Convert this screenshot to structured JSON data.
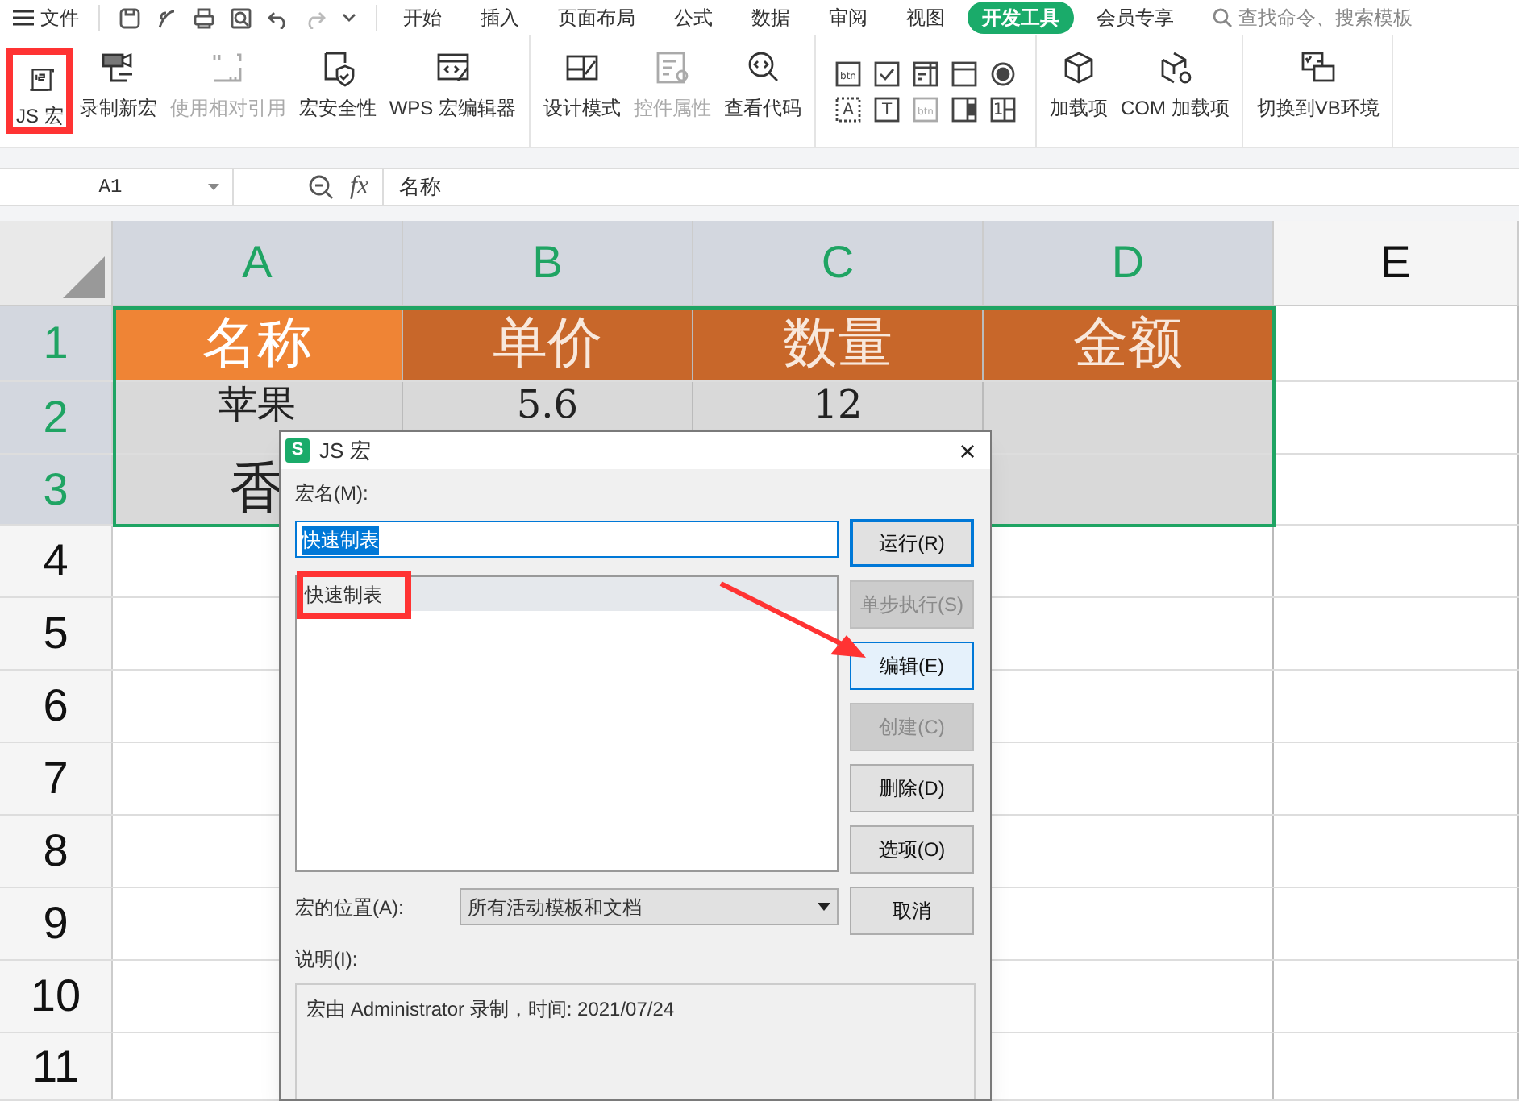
{
  "menu": {
    "label": "文件",
    "tabs": [
      {
        "label": "开始",
        "selected": false
      },
      {
        "label": "插入",
        "selected": false
      },
      {
        "label": "页面布局",
        "selected": false
      },
      {
        "label": "公式",
        "selected": false
      },
      {
        "label": "数据",
        "selected": false
      },
      {
        "label": "审阅",
        "selected": false
      },
      {
        "label": "视图",
        "selected": false
      },
      {
        "label": "开发工具",
        "selected": true
      },
      {
        "label": "会员专享",
        "selected": false
      }
    ],
    "search": {
      "placeholder": "查找命令、搜索模板"
    }
  },
  "ribbon": {
    "groups": [
      [
        {
          "label": "JS 宏",
          "disabled": false,
          "highlighted": true
        },
        {
          "label": "录制新宏",
          "disabled": false,
          "highlighted": false
        },
        {
          "label": "使用相对引用",
          "disabled": true,
          "highlighted": false
        },
        {
          "label": "宏安全性",
          "disabled": false,
          "highlighted": false
        },
        {
          "label": "WPS 宏编辑器",
          "disabled": false,
          "highlighted": false
        }
      ],
      [
        {
          "label": "设计模式",
          "disabled": false,
          "highlighted": false
        },
        {
          "label": "控件属性",
          "disabled": true,
          "highlighted": false
        },
        {
          "label": "查看代码",
          "disabled": false,
          "highlighted": false
        }
      ],
      [
        {
          "label": "加载项",
          "disabled": false,
          "highlighted": false
        },
        {
          "label": "COM 加载项",
          "disabled": false,
          "highlighted": false
        }
      ],
      [
        {
          "label": "切换到VB环境",
          "disabled": false,
          "highlighted": false
        }
      ]
    ],
    "controls": [
      {
        "kind": "button",
        "glyph": "btn",
        "disabled": false
      },
      {
        "kind": "checkbox",
        "disabled": false
      },
      {
        "kind": "combo",
        "disabled": false
      },
      {
        "kind": "list",
        "disabled": false
      },
      {
        "kind": "radio",
        "disabled": false
      },
      {
        "kind": "label",
        "glyph": "A",
        "disabled": false
      },
      {
        "kind": "textbox",
        "glyph": "T",
        "disabled": false
      },
      {
        "kind": "button",
        "glyph": "btn",
        "disabled": true
      },
      {
        "kind": "scroll",
        "disabled": false
      },
      {
        "kind": "spin",
        "glyph": "1",
        "disabled": false
      }
    ]
  },
  "formula_bar": {
    "cell": "A1",
    "fx": "fx",
    "value": "名称"
  },
  "sheet": {
    "columns": [
      {
        "label": "A",
        "selected": true
      },
      {
        "label": "B",
        "selected": true
      },
      {
        "label": "C",
        "selected": true
      },
      {
        "label": "D",
        "selected": true
      },
      {
        "label": "E",
        "selected": false
      }
    ],
    "rows": [
      {
        "label": "1",
        "selected": true,
        "cells": [
          "名称",
          "单价",
          "数量",
          "金额",
          ""
        ]
      },
      {
        "label": "2",
        "selected": true,
        "cells": [
          "苹果",
          "5.6",
          "12",
          "",
          ""
        ]
      },
      {
        "label": "3",
        "selected": true,
        "cells": [
          "香",
          "",
          "",
          "",
          ""
        ]
      },
      {
        "label": "4",
        "selected": false,
        "cells": []
      },
      {
        "label": "5",
        "selected": false,
        "cells": []
      },
      {
        "label": "6",
        "selected": false,
        "cells": []
      },
      {
        "label": "7",
        "selected": false,
        "cells": []
      },
      {
        "label": "8",
        "selected": false,
        "cells": []
      },
      {
        "label": "9",
        "selected": false,
        "cells": []
      },
      {
        "label": "10",
        "selected": false,
        "cells": []
      },
      {
        "label": "11",
        "selected": false,
        "cells": []
      }
    ]
  },
  "dialog": {
    "logo_text": "S",
    "title": "JS 宏",
    "close": "×",
    "name_label": "宏名(M):",
    "name_value": "快速制表",
    "macros": [
      {
        "label": "快速制表",
        "selected": true,
        "highlighted": true
      }
    ],
    "buttons": [
      {
        "label": "运行(R)",
        "disabled": false,
        "focused": true,
        "hovered": false
      },
      {
        "label": "单步执行(S)",
        "disabled": true,
        "focused": false,
        "hovered": false
      },
      {
        "label": "编辑(E)",
        "disabled": false,
        "focused": false,
        "hovered": true
      },
      {
        "label": "创建(C)",
        "disabled": true,
        "focused": false,
        "hovered": false
      },
      {
        "label": "删除(D)",
        "disabled": false,
        "focused": false,
        "hovered": false
      },
      {
        "label": "选项(O)",
        "disabled": false,
        "focused": false,
        "hovered": false
      },
      {
        "label": "取消",
        "disabled": false,
        "focused": false,
        "hovered": false
      }
    ],
    "location_label": "宏的位置(A):",
    "location_value": "所有活动模板和文档",
    "description_label": "说明(I):",
    "description": "宏由 Administrator 录制，时间: 2021/07/24"
  }
}
